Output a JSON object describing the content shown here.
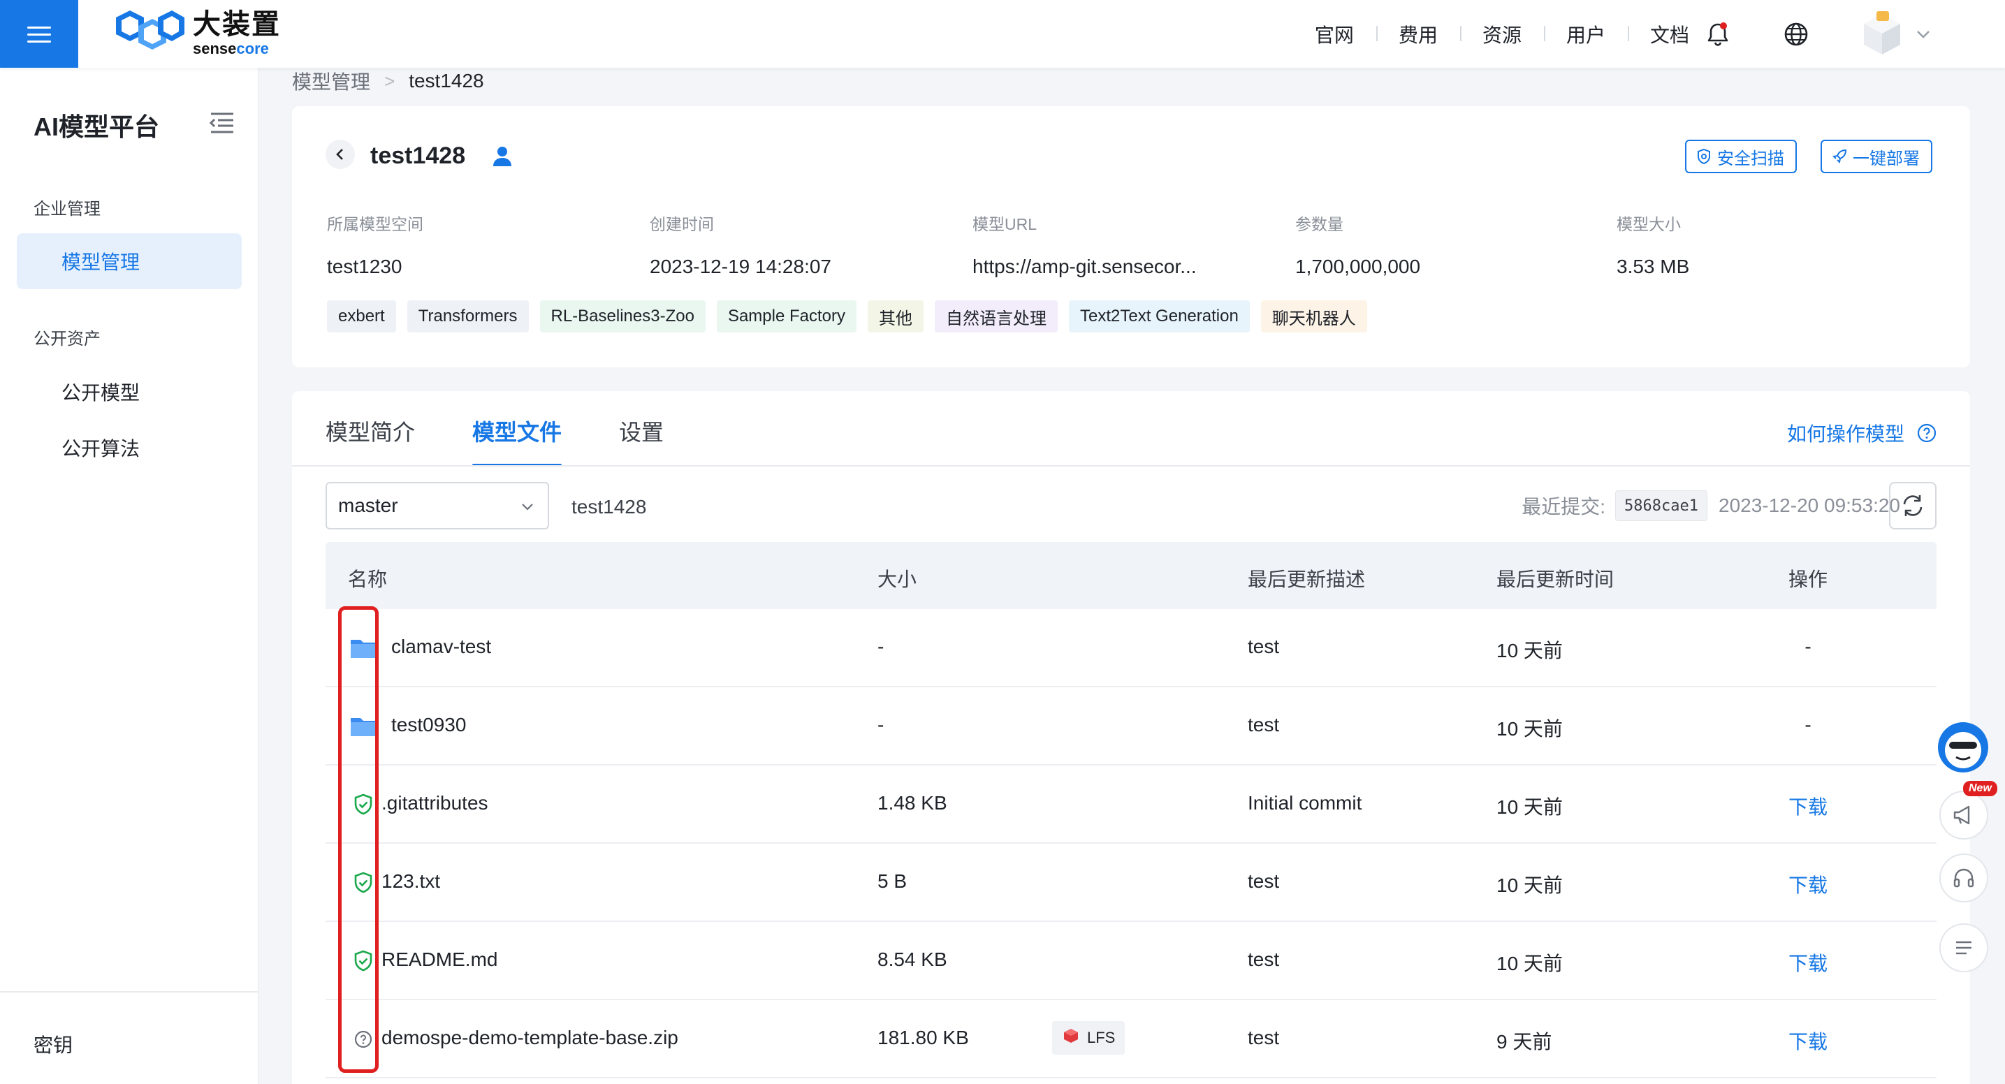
{
  "topbar": {
    "brand_cn": "大装置",
    "brand_en_1": "sense",
    "brand_en_2": "core",
    "nav": [
      "官网",
      "费用",
      "资源",
      "用户",
      "文档"
    ]
  },
  "sidebar": {
    "title": "AI模型平台",
    "group_enterprise": "企业管理",
    "item_model_manage": "模型管理",
    "group_public": "公开资产",
    "item_public_model": "公开模型",
    "item_public_algo": "公开算法",
    "footer": "密钥"
  },
  "breadcrumb": {
    "parent": "模型管理",
    "sep": ">",
    "current": "test1428"
  },
  "model": {
    "name": "test1428",
    "btn_scan": "安全扫描",
    "btn_deploy": "一键部署",
    "meta": [
      {
        "key": "所属模型空间",
        "value": "test1230"
      },
      {
        "key": "创建时间",
        "value": "2023-12-19 14:28:07"
      },
      {
        "key": "模型URL",
        "value": "https://amp-git.sensecor..."
      },
      {
        "key": "参数量",
        "value": "1,700,000,000"
      },
      {
        "key": "模型大小",
        "value": "3.53 MB"
      }
    ],
    "tags": [
      {
        "label": "exbert",
        "color": "#eef1f6"
      },
      {
        "label": "Transformers",
        "color": "#eef1f6"
      },
      {
        "label": "RL-Baselines3-Zoo",
        "color": "#eaf7f0"
      },
      {
        "label": "Sample Factory",
        "color": "#eaf7f0"
      },
      {
        "label": "其他",
        "color": "#f3f6e6"
      },
      {
        "label": "自然语言处理",
        "color": "#f2ecfb"
      },
      {
        "label": "Text2Text Generation",
        "color": "#e8f4fb"
      },
      {
        "label": "聊天机器人",
        "color": "#fdf3e7"
      }
    ]
  },
  "files": {
    "tabs": [
      "模型简介",
      "模型文件",
      "设置"
    ],
    "active_tab": 1,
    "howto": "如何操作模型",
    "branch": "master",
    "repo": "test1428",
    "commit_label": "最近提交:",
    "commit_hash": "5868cae1",
    "commit_time": "2023-12-20 09:53:20",
    "columns": {
      "name": "名称",
      "size": "大小",
      "desc": "最后更新描述",
      "time": "最后更新时间",
      "op": "操作"
    },
    "rows": [
      {
        "type": "folder",
        "name": "clamav-test",
        "size": "-",
        "desc": "test",
        "time": "10 天前",
        "op": "-"
      },
      {
        "type": "folder",
        "name": "test0930",
        "size": "-",
        "desc": "test",
        "time": "10 天前",
        "op": "-"
      },
      {
        "type": "safe",
        "name": ".gitattributes",
        "size": "1.48 KB",
        "desc": "Initial commit",
        "time": "10 天前",
        "op": "下载"
      },
      {
        "type": "safe",
        "name": "123.txt",
        "size": "5 B",
        "desc": "test",
        "time": "10 天前",
        "op": "下载"
      },
      {
        "type": "safe",
        "name": "README.md",
        "size": "8.54 KB",
        "desc": "test",
        "time": "10 天前",
        "op": "下载"
      },
      {
        "type": "unknown",
        "name": "demospe-demo-template-base.zip",
        "size": "181.80 KB",
        "lfs": "LFS",
        "desc": "test",
        "time": "9 天前",
        "op": "下载"
      }
    ]
  },
  "float": {
    "new_badge": "New"
  },
  "colors": {
    "accent": "#1677e5",
    "highlight": "#e02020",
    "safe": "#1aa84b"
  }
}
